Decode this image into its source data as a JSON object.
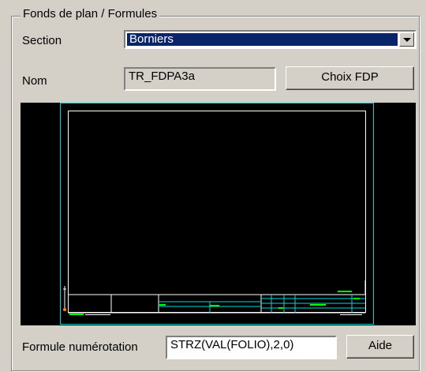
{
  "group": {
    "title": "Fonds de plan / Formules"
  },
  "section": {
    "label": "Section",
    "value": "Borniers"
  },
  "nom": {
    "label": "Nom",
    "value": "TR_FDPA3a",
    "choose_button": "Choix FDP"
  },
  "preview": {
    "description_icon": "drawing-sheet-preview"
  },
  "formula": {
    "label": "Formule numérotation",
    "value": "STRZ(VAL(FOLIO),2,0)",
    "help_button": "Aide"
  },
  "colors": {
    "face": "#d4d0c8",
    "highlight": "#0a246a",
    "cyan": "#00d7d7",
    "green": "#00ff00"
  }
}
